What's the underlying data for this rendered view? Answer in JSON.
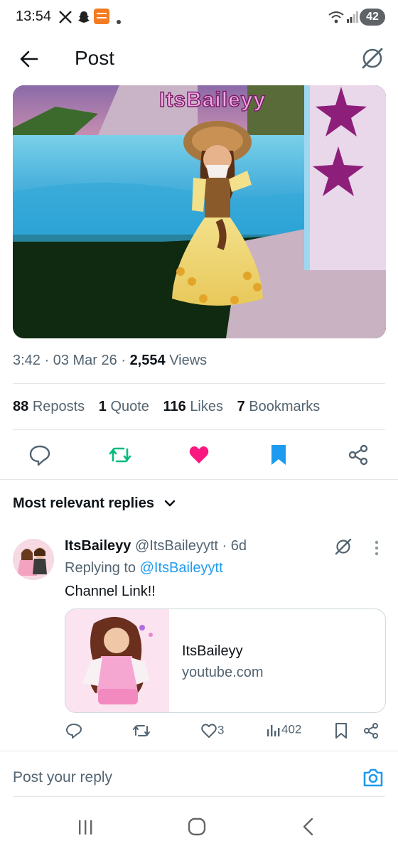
{
  "status_bar": {
    "time": "13:54",
    "battery": "42",
    "icons": [
      "x-logo-icon",
      "snapchat-icon",
      "temu-icon",
      "dot-icon",
      "wifi-icon",
      "signal-icon"
    ]
  },
  "header": {
    "title": "Post",
    "back_icon": "arrow-left-icon",
    "right_icon": "grok-icon"
  },
  "media": {
    "watermark": "ItsBaileyy"
  },
  "post_meta": {
    "time": "3:42",
    "date": "03 Mar 26",
    "views_count": "2,554",
    "views_label": "Views"
  },
  "stats": [
    {
      "count": "88",
      "label": "Reposts"
    },
    {
      "count": "1",
      "label": "Quote"
    },
    {
      "count": "116",
      "label": "Likes"
    },
    {
      "count": "7",
      "label": "Bookmarks"
    }
  ],
  "action_bar": {
    "icons": [
      "reply-icon",
      "repost-icon",
      "like-icon",
      "bookmark-icon",
      "share-icon"
    ],
    "colors": {
      "repost": "#00ba7c",
      "like": "#f91880",
      "bookmark": "#1d9bf0"
    }
  },
  "replies_filter": {
    "label": "Most relevant replies"
  },
  "reply": {
    "name": "ItsBaileyy",
    "handle": "@ItsBaileyytt",
    "time": "· 6d",
    "replying_prefix": "Replying to",
    "replying_to": "@ItsBaileyytt",
    "text": "Channel Link!!",
    "card": {
      "title": "ItsBaileyy",
      "domain": "youtube.com"
    },
    "likes": "3",
    "views": "402"
  },
  "composer": {
    "placeholder": "Post your reply"
  },
  "theme": {
    "accent": "#1d9bf0",
    "text": "#0f1419",
    "muted": "#536471"
  }
}
